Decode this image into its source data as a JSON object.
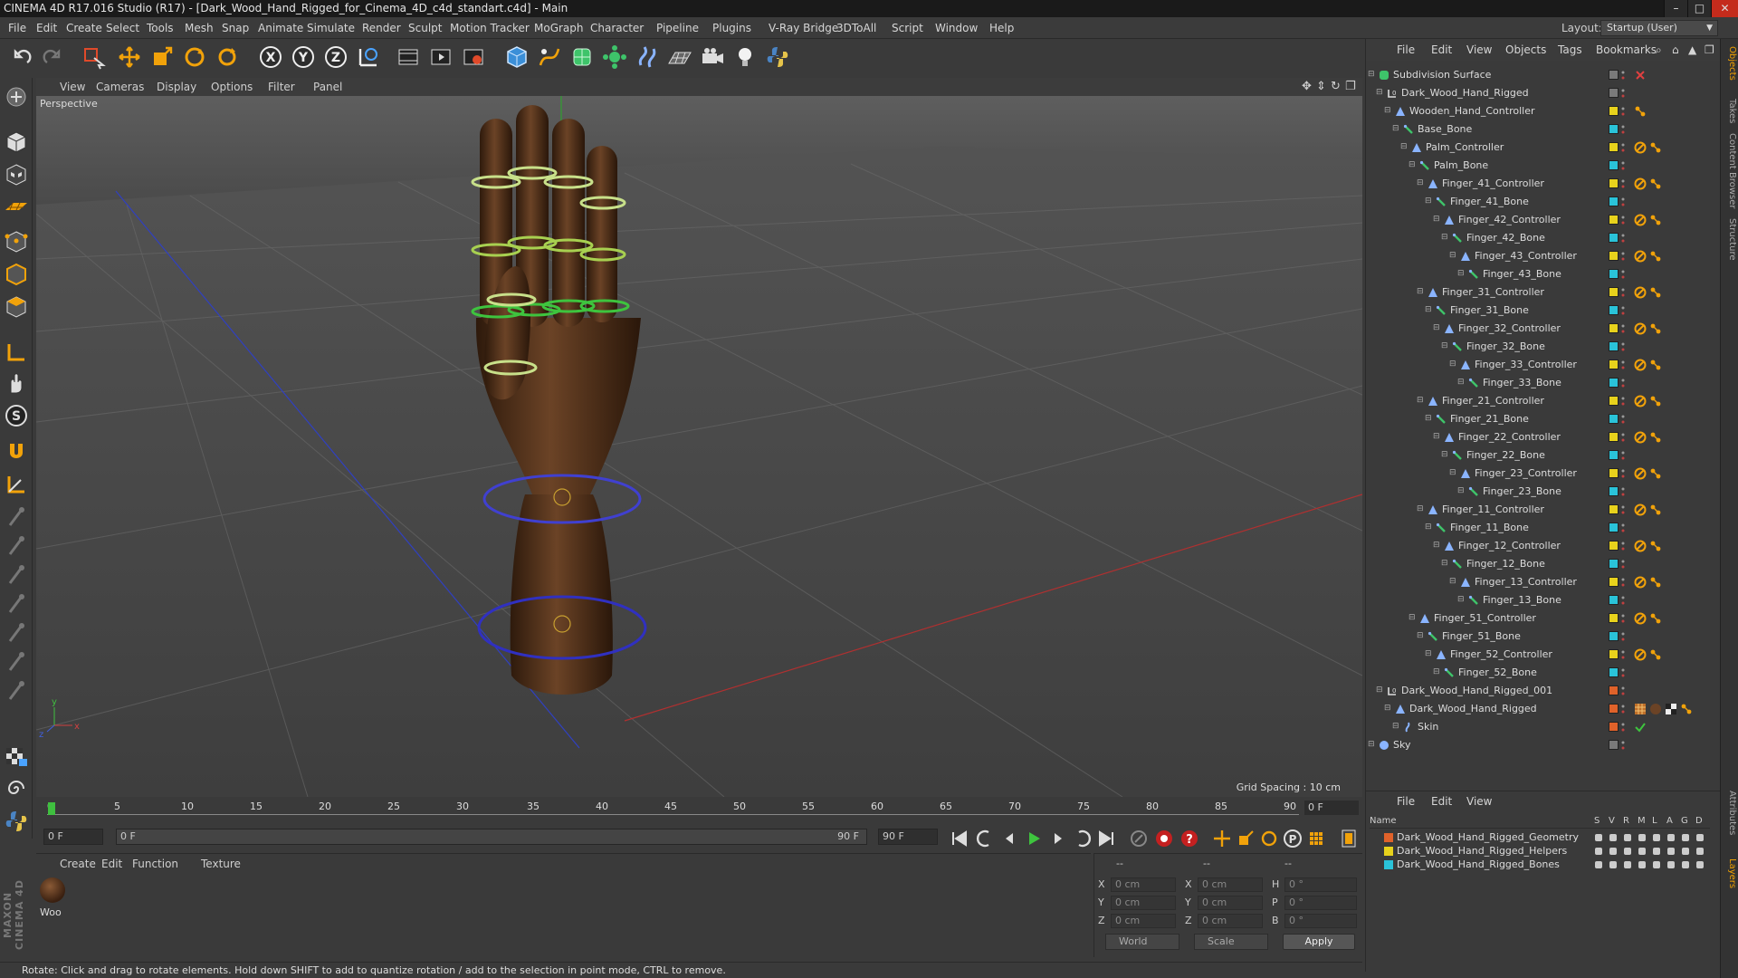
{
  "window": {
    "title": "CINEMA 4D R17.016 Studio (R17) - [Dark_Wood_Hand_Rigged_for_Cinema_4D_c4d_standart.c4d] - Main",
    "minimize": "–",
    "maximize": "□",
    "close": "✕"
  },
  "menubar": {
    "items": [
      "File",
      "Edit",
      "Create",
      "Select",
      "Tools",
      "Mesh",
      "Snap",
      "Animate",
      "Simulate",
      "Render",
      "Sculpt",
      "Motion Tracker",
      "MoGraph",
      "Character",
      "Pipeline",
      "Plugins",
      "V-Ray Bridge",
      "3DToAll",
      "Script",
      "Window",
      "Help"
    ],
    "layout_label": "Layout:",
    "layout_value": "Startup (User)"
  },
  "toolbar": {
    "icons": [
      "undo-icon",
      "redo-icon",
      "live-selection-icon",
      "move-icon",
      "scale-icon",
      "rotate-icon",
      "recent-tool-icon",
      "x-axis-icon",
      "y-axis-icon",
      "z-axis-icon",
      "coordinate-system-icon",
      "render-view-icon",
      "render-picture-viewer-icon",
      "render-settings-icon",
      "cube-icon",
      "pen-spline-icon",
      "subdivision-icon",
      "array-icon",
      "deformer-icon",
      "floor-icon",
      "camera-icon",
      "light-icon",
      "python-icon"
    ],
    "axis_x": "X",
    "axis_y": "Y",
    "axis_z": "Z"
  },
  "viewport": {
    "menu": [
      "View",
      "Cameras",
      "Display",
      "Options",
      "Filter",
      "Panel"
    ],
    "view_name": "Perspective",
    "grid_spacing": "Grid Spacing : 10 cm",
    "axis_x": "x",
    "axis_y": "y",
    "axis_z": "z"
  },
  "timeline": {
    "ticks": [
      "0",
      "5",
      "10",
      "15",
      "20",
      "25",
      "30",
      "35",
      "40",
      "45",
      "50",
      "55",
      "60",
      "65",
      "70",
      "75",
      "80",
      "85",
      "90"
    ],
    "current_frame": "0 F",
    "start_field": "0 F",
    "range_start": "0 F",
    "range_end": "90 F",
    "end_field": "90 F"
  },
  "material_manager": {
    "menu": [
      "Create",
      "Edit",
      "Function",
      "Texture"
    ],
    "materials": [
      {
        "label": "Woo"
      }
    ]
  },
  "coordinates": {
    "header": [
      "--",
      "--",
      "--"
    ],
    "rows": [
      {
        "a": "X",
        "a_val": "0 cm",
        "b": "X",
        "b_val": "0 cm",
        "c": "H",
        "c_val": "0 °"
      },
      {
        "a": "Y",
        "a_val": "0 cm",
        "b": "Y",
        "b_val": "0 cm",
        "c": "P",
        "c_val": "0 °"
      },
      {
        "a": "Z",
        "a_val": "0 cm",
        "b": "Z",
        "b_val": "0 cm",
        "c": "B",
        "c_val": "0 °"
      }
    ],
    "mode_world": "World",
    "mode_scale": "Scale",
    "apply": "Apply"
  },
  "statusbar": {
    "text": "Rotate: Click and drag to rotate elements. Hold down SHIFT to add to quantize rotation / add to the selection in point mode, CTRL to remove."
  },
  "object_manager": {
    "menu": [
      "File",
      "Edit",
      "View",
      "Objects",
      "Tags",
      "Bookmarks"
    ],
    "objects": [
      {
        "name": "Subdivision Surface",
        "depth": 0,
        "icon": "subdivision-icon",
        "color": "#7a7a7a",
        "tags": [
          "close"
        ]
      },
      {
        "name": "Dark_Wood_Hand_Rigged",
        "depth": 1,
        "icon": "null-icon",
        "color": "#7a7a7a",
        "tags": []
      },
      {
        "name": "Wooden_Hand_Controller",
        "depth": 2,
        "icon": "joint-icon",
        "color": "#e8d21c",
        "tags": [
          "ik"
        ]
      },
      {
        "name": "Base_Bone",
        "depth": 3,
        "icon": "bone-icon",
        "color": "#2ac3d9",
        "tags": []
      },
      {
        "name": "Palm_Controller",
        "depth": 4,
        "icon": "joint-icon",
        "color": "#e8d21c",
        "tags": [
          "protect",
          "ik"
        ]
      },
      {
        "name": "Palm_Bone",
        "depth": 5,
        "icon": "bone-icon",
        "color": "#2ac3d9",
        "tags": []
      },
      {
        "name": "Finger_41_Controller",
        "depth": 6,
        "icon": "joint-icon",
        "color": "#e8d21c",
        "tags": [
          "protect",
          "ik"
        ]
      },
      {
        "name": "Finger_41_Bone",
        "depth": 7,
        "icon": "bone-icon",
        "color": "#2ac3d9",
        "tags": []
      },
      {
        "name": "Finger_42_Controller",
        "depth": 8,
        "icon": "joint-icon",
        "color": "#e8d21c",
        "tags": [
          "protect",
          "ik"
        ]
      },
      {
        "name": "Finger_42_Bone",
        "depth": 9,
        "icon": "bone-icon",
        "color": "#2ac3d9",
        "tags": []
      },
      {
        "name": "Finger_43_Controller",
        "depth": 10,
        "icon": "joint-icon",
        "color": "#e8d21c",
        "tags": [
          "protect",
          "ik"
        ]
      },
      {
        "name": "Finger_43_Bone",
        "depth": 11,
        "icon": "bone-icon",
        "color": "#2ac3d9",
        "tags": []
      },
      {
        "name": "Finger_31_Controller",
        "depth": 6,
        "icon": "joint-icon",
        "color": "#e8d21c",
        "tags": [
          "protect",
          "ik"
        ]
      },
      {
        "name": "Finger_31_Bone",
        "depth": 7,
        "icon": "bone-icon",
        "color": "#2ac3d9",
        "tags": []
      },
      {
        "name": "Finger_32_Controller",
        "depth": 8,
        "icon": "joint-icon",
        "color": "#e8d21c",
        "tags": [
          "protect",
          "ik"
        ]
      },
      {
        "name": "Finger_32_Bone",
        "depth": 9,
        "icon": "bone-icon",
        "color": "#2ac3d9",
        "tags": []
      },
      {
        "name": "Finger_33_Controller",
        "depth": 10,
        "icon": "joint-icon",
        "color": "#e8d21c",
        "tags": [
          "protect",
          "ik"
        ]
      },
      {
        "name": "Finger_33_Bone",
        "depth": 11,
        "icon": "bone-icon",
        "color": "#2ac3d9",
        "tags": []
      },
      {
        "name": "Finger_21_Controller",
        "depth": 6,
        "icon": "joint-icon",
        "color": "#e8d21c",
        "tags": [
          "protect",
          "ik"
        ]
      },
      {
        "name": "Finger_21_Bone",
        "depth": 7,
        "icon": "bone-icon",
        "color": "#2ac3d9",
        "tags": []
      },
      {
        "name": "Finger_22_Controller",
        "depth": 8,
        "icon": "joint-icon",
        "color": "#e8d21c",
        "tags": [
          "protect",
          "ik"
        ]
      },
      {
        "name": "Finger_22_Bone",
        "depth": 9,
        "icon": "bone-icon",
        "color": "#2ac3d9",
        "tags": []
      },
      {
        "name": "Finger_23_Controller",
        "depth": 10,
        "icon": "joint-icon",
        "color": "#e8d21c",
        "tags": [
          "protect",
          "ik"
        ]
      },
      {
        "name": "Finger_23_Bone",
        "depth": 11,
        "icon": "bone-icon",
        "color": "#2ac3d9",
        "tags": []
      },
      {
        "name": "Finger_11_Controller",
        "depth": 6,
        "icon": "joint-icon",
        "color": "#e8d21c",
        "tags": [
          "protect",
          "ik"
        ]
      },
      {
        "name": "Finger_11_Bone",
        "depth": 7,
        "icon": "bone-icon",
        "color": "#2ac3d9",
        "tags": []
      },
      {
        "name": "Finger_12_Controller",
        "depth": 8,
        "icon": "joint-icon",
        "color": "#e8d21c",
        "tags": [
          "protect",
          "ik"
        ]
      },
      {
        "name": "Finger_12_Bone",
        "depth": 9,
        "icon": "bone-icon",
        "color": "#2ac3d9",
        "tags": []
      },
      {
        "name": "Finger_13_Controller",
        "depth": 10,
        "icon": "joint-icon",
        "color": "#e8d21c",
        "tags": [
          "protect",
          "ik"
        ]
      },
      {
        "name": "Finger_13_Bone",
        "depth": 11,
        "icon": "bone-icon",
        "color": "#2ac3d9",
        "tags": []
      },
      {
        "name": "Finger_51_Controller",
        "depth": 5,
        "icon": "joint-icon",
        "color": "#e8d21c",
        "tags": [
          "protect",
          "ik"
        ]
      },
      {
        "name": "Finger_51_Bone",
        "depth": 6,
        "icon": "bone-icon",
        "color": "#2ac3d9",
        "tags": []
      },
      {
        "name": "Finger_52_Controller",
        "depth": 7,
        "icon": "joint-icon",
        "color": "#e8d21c",
        "tags": [
          "protect",
          "ik"
        ]
      },
      {
        "name": "Finger_52_Bone",
        "depth": 8,
        "icon": "bone-icon",
        "color": "#2ac3d9",
        "tags": []
      },
      {
        "name": "Dark_Wood_Hand_Rigged_001",
        "depth": 1,
        "icon": "null-icon",
        "color": "#e0622a",
        "tags": []
      },
      {
        "name": "Dark_Wood_Hand_Rigged",
        "depth": 2,
        "icon": "mesh-icon",
        "color": "#e0622a",
        "tags": [
          "texture",
          "material",
          "checker",
          "ik"
        ]
      },
      {
        "name": "Skin",
        "depth": 3,
        "icon": "skin-icon",
        "color": "#e0622a",
        "tags": [
          "check"
        ]
      },
      {
        "name": "Sky",
        "depth": 0,
        "icon": "sky-icon",
        "color": "#7a7a7a",
        "tags": []
      }
    ]
  },
  "layer_manager": {
    "menu": [
      "File",
      "Edit",
      "View"
    ],
    "columns": [
      "Name",
      "S",
      "V",
      "R",
      "M",
      "L",
      "A",
      "G",
      "D"
    ],
    "layers": [
      {
        "name": "Dark_Wood_Hand_Rigged_Geometry",
        "color": "#e0622a"
      },
      {
        "name": "Dark_Wood_Hand_Rigged_Helpers",
        "color": "#e8d21c"
      },
      {
        "name": "Dark_Wood_Hand_Rigged_Bones",
        "color": "#2ac3d9"
      }
    ]
  },
  "right_tabs": [
    "Objects",
    "Takes",
    "Content Browser",
    "Structure",
    "Attributes",
    "Layers"
  ],
  "maxon_logo": "MAXON CINEMA 4D"
}
